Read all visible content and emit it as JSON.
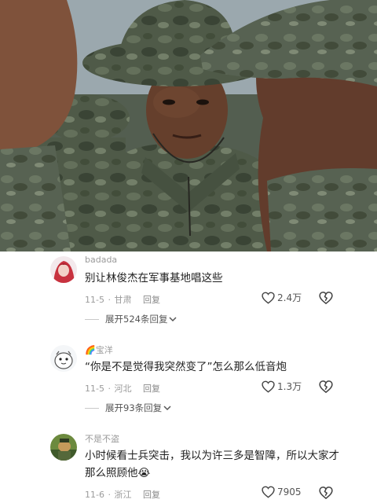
{
  "comments": [
    {
      "username": "badada",
      "text": "别让林俊杰在军事基地唱这些",
      "date": "11-5",
      "location": "甘肃",
      "reply_label": "回复",
      "likes": "2.4万",
      "expand_label": "展开524条回复"
    },
    {
      "username_emoji": "🌈",
      "username": "宝洋",
      "text": "“你是不是觉得我突然变了”怎么那么低音炮",
      "date": "11-5",
      "location": "河北",
      "reply_label": "回复",
      "likes": "1.3万",
      "expand_label": "展开93条回复"
    },
    {
      "username": "不是不盗",
      "text": "小时候看士兵突击，我以为许三多是智障，所以大家才那么照顾他😭",
      "date": "11-6",
      "location": "浙江",
      "reply_label": "回复",
      "likes": "7905"
    }
  ],
  "icons": {
    "like": "heart-outline-icon",
    "dislike": "broken-heart-outline-icon",
    "expand": "chevron-down-icon"
  },
  "colors": {
    "text": "#1f1f1f",
    "meta": "#9b9b9b",
    "camo_dark": "#3d473a",
    "camo_light": "#7f8c6f"
  }
}
